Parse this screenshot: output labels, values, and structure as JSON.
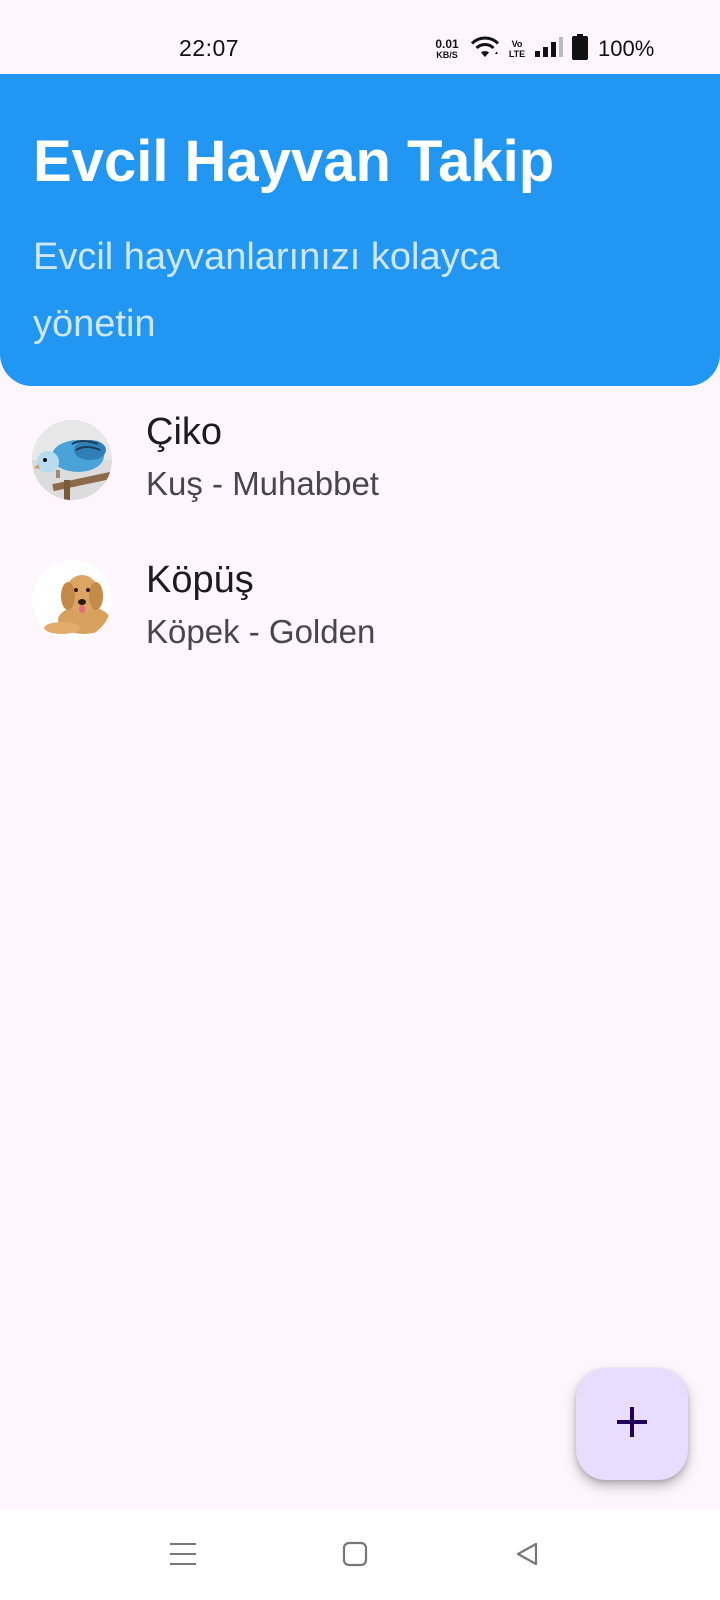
{
  "status_bar": {
    "time": "22:07",
    "net_speed_value": "0.01",
    "net_speed_unit": "KB/S",
    "volte_top": "Vo",
    "volte_bottom": "LTE",
    "battery_percent": "100%",
    "icons": [
      "wifi-icon",
      "signal-icon",
      "battery-icon"
    ]
  },
  "header": {
    "title": "Evcil Hayvan Takip",
    "subtitle": "Evcil hayvanlarınızı kolayca yönetin",
    "color": "#2196f3"
  },
  "pets": [
    {
      "name": "Çiko",
      "detail": "Kuş - Muhabbet",
      "avatar": "budgie-photo"
    },
    {
      "name": "Köpüş",
      "detail": "Köpek - Golden",
      "avatar": "golden-retriever-photo"
    }
  ],
  "fab": {
    "icon": "plus-icon",
    "color": "#eadcfd"
  },
  "nav_bar": {
    "items": [
      "menu-icon",
      "home-square-icon",
      "back-triangle-icon"
    ]
  }
}
